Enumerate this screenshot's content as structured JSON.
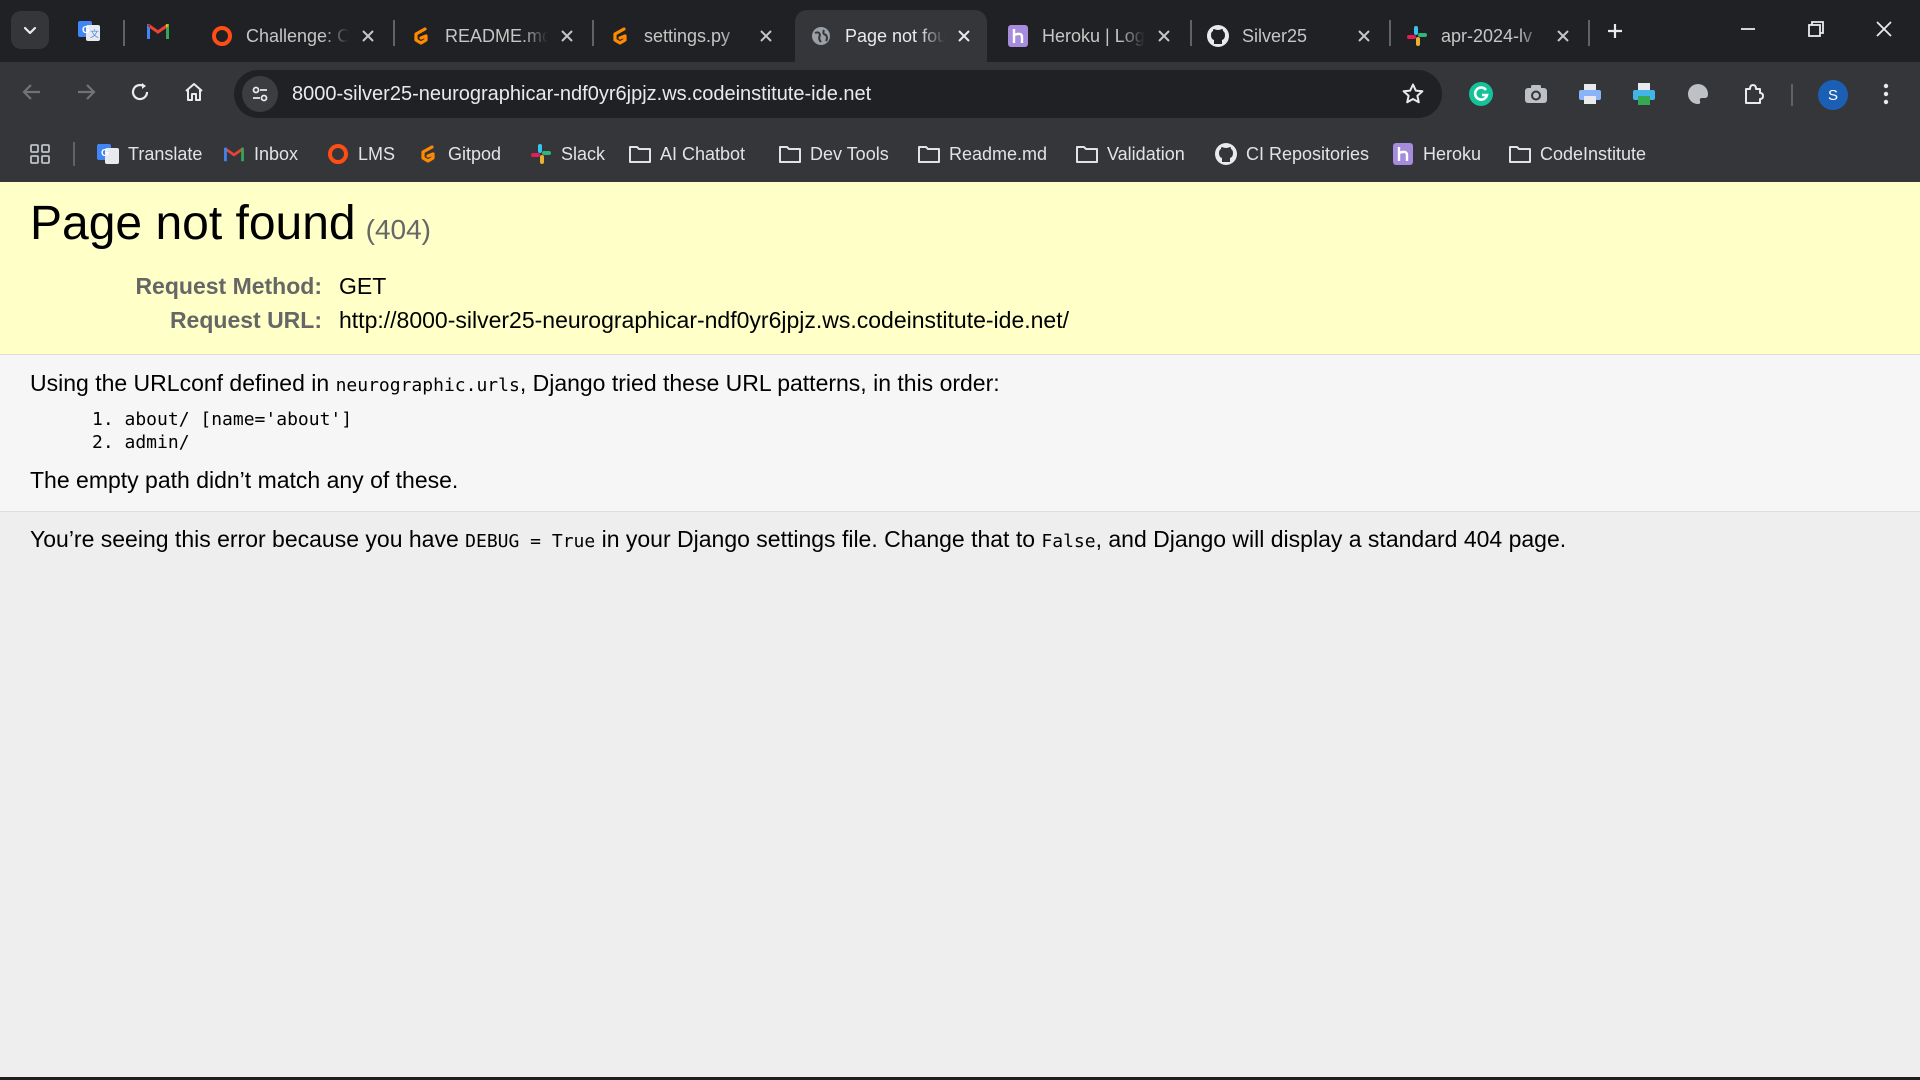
{
  "tabs": [
    {
      "title": "Challenge: C",
      "icon": "codeinstitute-icon",
      "active": false
    },
    {
      "title": "README.md",
      "icon": "gitpod-icon",
      "active": false
    },
    {
      "title": "settings.py",
      "icon": "gitpod-icon",
      "active": false
    },
    {
      "title": "Page not found",
      "icon": "globe-icon",
      "active": true
    },
    {
      "title": "Heroku | Login",
      "icon": "heroku-icon",
      "active": false
    },
    {
      "title": "Silver25",
      "icon": "github-icon",
      "active": false
    },
    {
      "title": "apr-2024-lv",
      "icon": "slack-icon",
      "active": false
    }
  ],
  "address_bar": {
    "url": "8000-silver25-neurographicar-ndf0yr6jpjz.ws.codeinstitute-ide.net"
  },
  "profile": {
    "initial": "S",
    "color": "#1a5fb4"
  },
  "bookmarks": [
    {
      "label": "Translate",
      "icon": "google-translate-icon"
    },
    {
      "label": "Inbox",
      "icon": "gmail-icon"
    },
    {
      "label": "LMS",
      "icon": "codeinstitute-icon"
    },
    {
      "label": "Gitpod",
      "icon": "gitpod-icon"
    },
    {
      "label": "Slack",
      "icon": "slack-icon"
    },
    {
      "label": "AI Chatbot",
      "icon": "folder-icon"
    },
    {
      "label": "Dev Tools",
      "icon": "folder-icon"
    },
    {
      "label": "Readme.md",
      "icon": "folder-icon"
    },
    {
      "label": "Validation",
      "icon": "folder-icon"
    },
    {
      "label": "CI Repositories",
      "icon": "github-icon"
    },
    {
      "label": "Heroku",
      "icon": "heroku-icon"
    },
    {
      "label": "CodeInstitute",
      "icon": "folder-icon"
    }
  ],
  "page": {
    "title": "Page not found",
    "status_code": "(404)",
    "request_method_label": "Request Method:",
    "request_method": "GET",
    "request_url_label": "Request URL:",
    "request_url": "http://8000-silver25-neurographicar-ndf0yr6jpjz.ws.codeinstitute-ide.net/",
    "urlconf_prefix": "Using the URLconf defined in ",
    "urlconf_module": "neurographic.urls",
    "urlconf_suffix": ", Django tried these URL patterns, in this order:",
    "patterns": [
      "1. about/ [name='about']",
      "2. admin/"
    ],
    "no_match": "The empty path didn’t match any of these.",
    "debug_prefix": "You’re seeing this error because you have ",
    "debug_setting": "DEBUG = True",
    "debug_middle": " in your Django settings file. Change that to ",
    "debug_false": "False",
    "debug_suffix": ", and Django will display a standard 404 page."
  },
  "colors": {
    "summary_bg": "#ffffc8",
    "info_bg": "#f6f6f6",
    "explanation_bg": "#eeeeee",
    "chrome_bg": "#35363a",
    "tabstrip_bg": "#202124"
  }
}
